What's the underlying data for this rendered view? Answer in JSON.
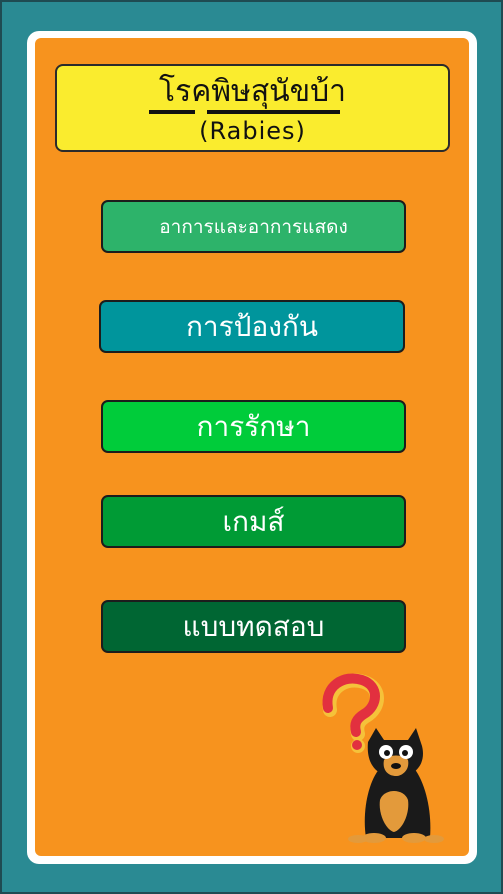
{
  "header": {
    "title_thai": "โรคพิษสุนัขบ้า",
    "title_english": "(Rabies)"
  },
  "menu": {
    "symptoms": "อาการและอาการแสดง",
    "prevention": "การป้องกัน",
    "treatment": "การรักษา",
    "game": "เกมส์",
    "quiz": "แบบทดสอบ"
  },
  "colors": {
    "frame": "#2a8a93",
    "panel": "#f7931e",
    "title_box": "#faec2e",
    "btn_symptoms": "#2db36a",
    "btn_prevention": "#00959c",
    "btn_treatment": "#00cc3a",
    "btn_game": "#009b35",
    "btn_quiz": "#006633"
  },
  "illustration": {
    "icon": "confused-dog-with-question-mark-icon"
  }
}
